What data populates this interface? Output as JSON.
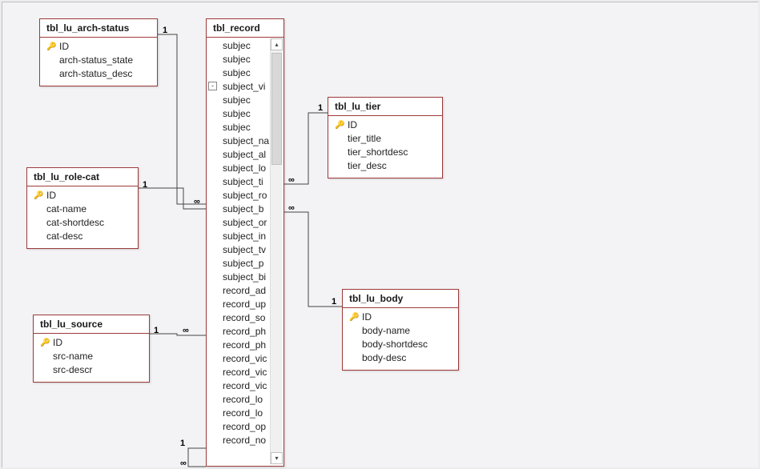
{
  "tables": {
    "arch": {
      "title": "tbl_lu_arch-status",
      "fields": [
        {
          "name": "ID",
          "pk": true
        },
        {
          "name": "arch-status_state",
          "pk": false
        },
        {
          "name": "arch-status_desc",
          "pk": false
        }
      ]
    },
    "rolecat": {
      "title": "tbl_lu_role-cat",
      "fields": [
        {
          "name": "ID",
          "pk": true
        },
        {
          "name": "cat-name",
          "pk": false
        },
        {
          "name": "cat-shortdesc",
          "pk": false
        },
        {
          "name": "cat-desc",
          "pk": false
        }
      ]
    },
    "source": {
      "title": "tbl_lu_source",
      "fields": [
        {
          "name": "ID",
          "pk": true
        },
        {
          "name": "src-name",
          "pk": false
        },
        {
          "name": "src-descr",
          "pk": false
        }
      ]
    },
    "tier": {
      "title": "tbl_lu_tier",
      "fields": [
        {
          "name": "ID",
          "pk": true
        },
        {
          "name": "tier_title",
          "pk": false
        },
        {
          "name": "tier_shortdesc",
          "pk": false
        },
        {
          "name": "tier_desc",
          "pk": false
        }
      ]
    },
    "body": {
      "title": "tbl_lu_body",
      "fields": [
        {
          "name": "ID",
          "pk": true
        },
        {
          "name": "body-name",
          "pk": false
        },
        {
          "name": "body-shortdesc",
          "pk": false
        },
        {
          "name": "body-desc",
          "pk": false
        }
      ]
    },
    "record": {
      "title": "tbl_record",
      "fields": [
        {
          "name": "subjec",
          "trunc": true
        },
        {
          "name": "subjec",
          "trunc": true
        },
        {
          "name": "subjec",
          "trunc": true
        },
        {
          "name": "subject_vi",
          "trunc": true,
          "expander": "-"
        },
        {
          "name": "subjec",
          "trunc": true
        },
        {
          "name": "subjec",
          "trunc": true
        },
        {
          "name": "subjec",
          "trunc": true
        },
        {
          "name": "subject_na",
          "trunc": true
        },
        {
          "name": "subject_al",
          "trunc": true
        },
        {
          "name": "subject_lo",
          "trunc": true
        },
        {
          "name": "subject_ti",
          "trunc": true
        },
        {
          "name": "subject_ro",
          "trunc": true
        },
        {
          "name": "subject_b",
          "trunc": true
        },
        {
          "name": "subject_or",
          "trunc": true
        },
        {
          "name": "subject_in",
          "trunc": true
        },
        {
          "name": "subject_tv",
          "trunc": true
        },
        {
          "name": "subject_p",
          "trunc": true
        },
        {
          "name": "subject_bi",
          "trunc": true
        },
        {
          "name": "record_ad",
          "trunc": true
        },
        {
          "name": "record_up",
          "trunc": true
        },
        {
          "name": "record_so",
          "trunc": true
        },
        {
          "name": "record_ph",
          "trunc": true
        },
        {
          "name": "record_ph",
          "trunc": true
        },
        {
          "name": "record_vic",
          "trunc": true
        },
        {
          "name": "record_vic",
          "trunc": true
        },
        {
          "name": "record_vic",
          "trunc": true
        },
        {
          "name": "record_lo",
          "trunc": true
        },
        {
          "name": "record_lo",
          "trunc": true
        },
        {
          "name": "record_op",
          "trunc": true
        },
        {
          "name": "record_no",
          "trunc": true
        }
      ]
    }
  },
  "cardinality": {
    "one": "1",
    "many": "∞"
  },
  "relationships": [
    {
      "from": "arch",
      "to": "record",
      "from_card": "one",
      "to_card": "many"
    },
    {
      "from": "rolecat",
      "to": "record",
      "from_card": "one",
      "to_card": "many"
    },
    {
      "from": "source",
      "to": "record",
      "from_card": "one",
      "to_card": "many"
    },
    {
      "from": "tier",
      "to": "record",
      "from_card": "one",
      "to_card": "many"
    },
    {
      "from": "body",
      "to": "record",
      "from_card": "one",
      "to_card": "many"
    },
    {
      "from": "record",
      "to": "record",
      "from_card": "one",
      "to_card": "many",
      "self": true
    }
  ]
}
